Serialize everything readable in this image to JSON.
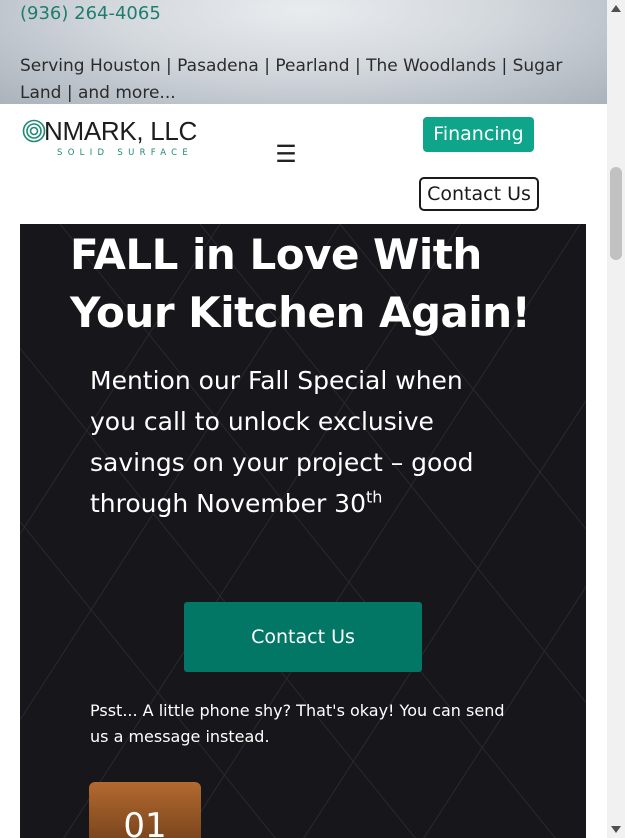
{
  "topbar": {
    "phone": "(936) 264-4065",
    "serving": "Serving Houston | Pasadena | Pearland | The Woodlands | Sugar Land | and more..."
  },
  "header": {
    "logo_text": "NMARK, LLC",
    "logo_subtext": "SOLID SURFACE",
    "menu_icon": "hamburger-menu-icon",
    "financing_label": "Financing",
    "contact_label": "Contact Us"
  },
  "hero": {
    "title": "FALL in Love With Your Kitchen Again!",
    "subtitle_main": "Mention our Fall Special when you call to unlock exclusive savings on your project – good through November 30",
    "subtitle_sup": "th",
    "contact_button": "Contact Us",
    "psst": "Psst... A little phone shy? That's okay! You can send us a message instead.",
    "step_number": "01"
  },
  "colors": {
    "accent": "#0fa58a",
    "accent_dark": "#037766",
    "hero_bg": "#17161b",
    "phone_text": "#1f7d6d"
  }
}
